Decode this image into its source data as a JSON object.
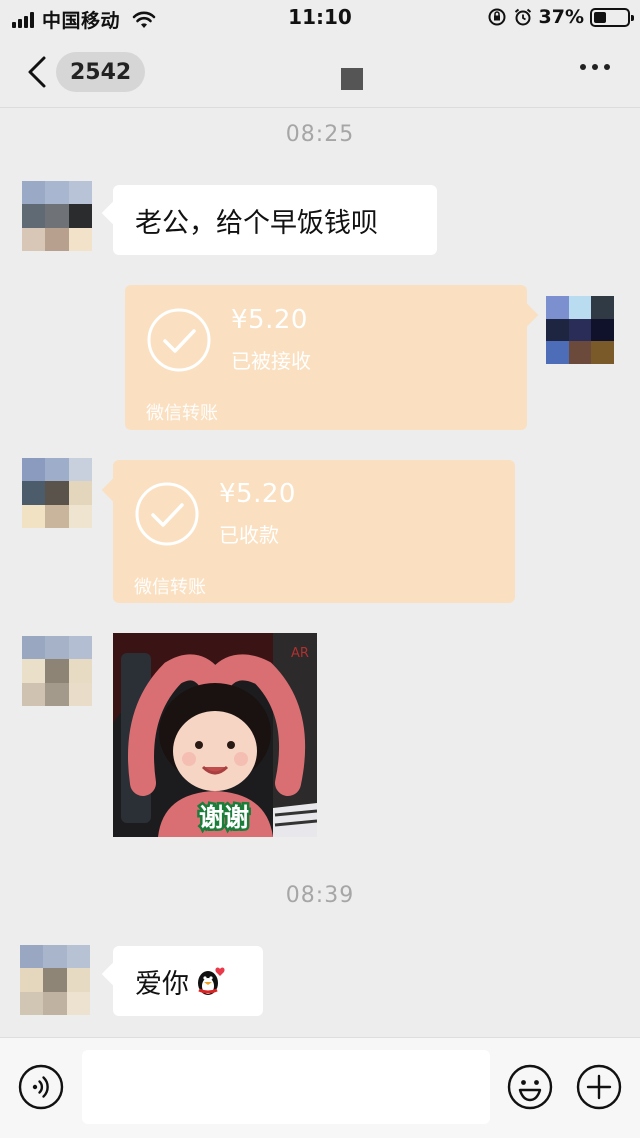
{
  "status_bar": {
    "carrier": "中国移动",
    "time": "11:10",
    "battery_percent": "37%",
    "battery_level": 0.37,
    "icons": [
      "signal-icon",
      "wifi-icon",
      "orientation-lock-icon",
      "alarm-icon",
      "battery-icon"
    ]
  },
  "nav": {
    "back_icon": "chevron-left-icon",
    "unread_count": "2542",
    "more_icon": "more-dots-icon"
  },
  "chat": {
    "timestamp_1": "08:25",
    "msg_1": {
      "text": "老公，给个早饭钱呗",
      "side": "left"
    },
    "transfer_1": {
      "side": "right",
      "amount": "¥5.20",
      "status": "已被接收",
      "footer": "微信转账",
      "color": "#fae0c0"
    },
    "transfer_2": {
      "side": "left",
      "amount": "¥5.20",
      "status": "已收款",
      "footer": "微信转账",
      "color": "#fae0c0"
    },
    "sticker": {
      "caption": "谢谢"
    },
    "timestamp_2": "08:39",
    "msg_2": {
      "text": "爱你",
      "emoji": "penguin-heart-icon",
      "side": "left"
    }
  },
  "input_bar": {
    "placeholder": "",
    "value": "",
    "icons": [
      "voice-icon",
      "emoji-icon",
      "plus-icon"
    ]
  },
  "colors": {
    "background": "#ededed",
    "bubble": "#ffffff",
    "transfer": "#fae0c0",
    "timestamp": "#a6a6a6"
  }
}
